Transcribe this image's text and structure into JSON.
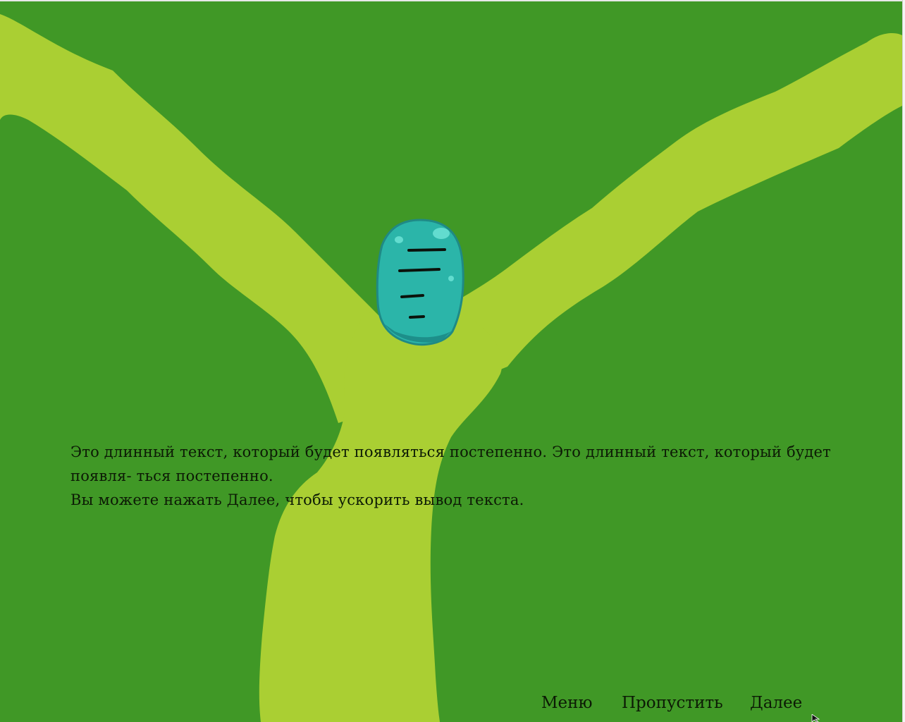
{
  "scene": {
    "background_color": "#409826",
    "tree_color": "#aacf33",
    "character_color": "#2bb5a9",
    "character_outline": "#1f8a85",
    "character_highlight": "#62dccf",
    "character_stripe_color": "#0b120b"
  },
  "dialogue": {
    "line1": "Это длинный текст, который будет появляться постепенно. Это длинный текст, который будет",
    "line2": "появля- ться постепенно.",
    "line3": "Вы можете нажать Далее, чтобы ускорить вывод текста."
  },
  "menu": {
    "menu_label": "Меню",
    "skip_label": "Пропустить",
    "next_label": "Далее"
  }
}
